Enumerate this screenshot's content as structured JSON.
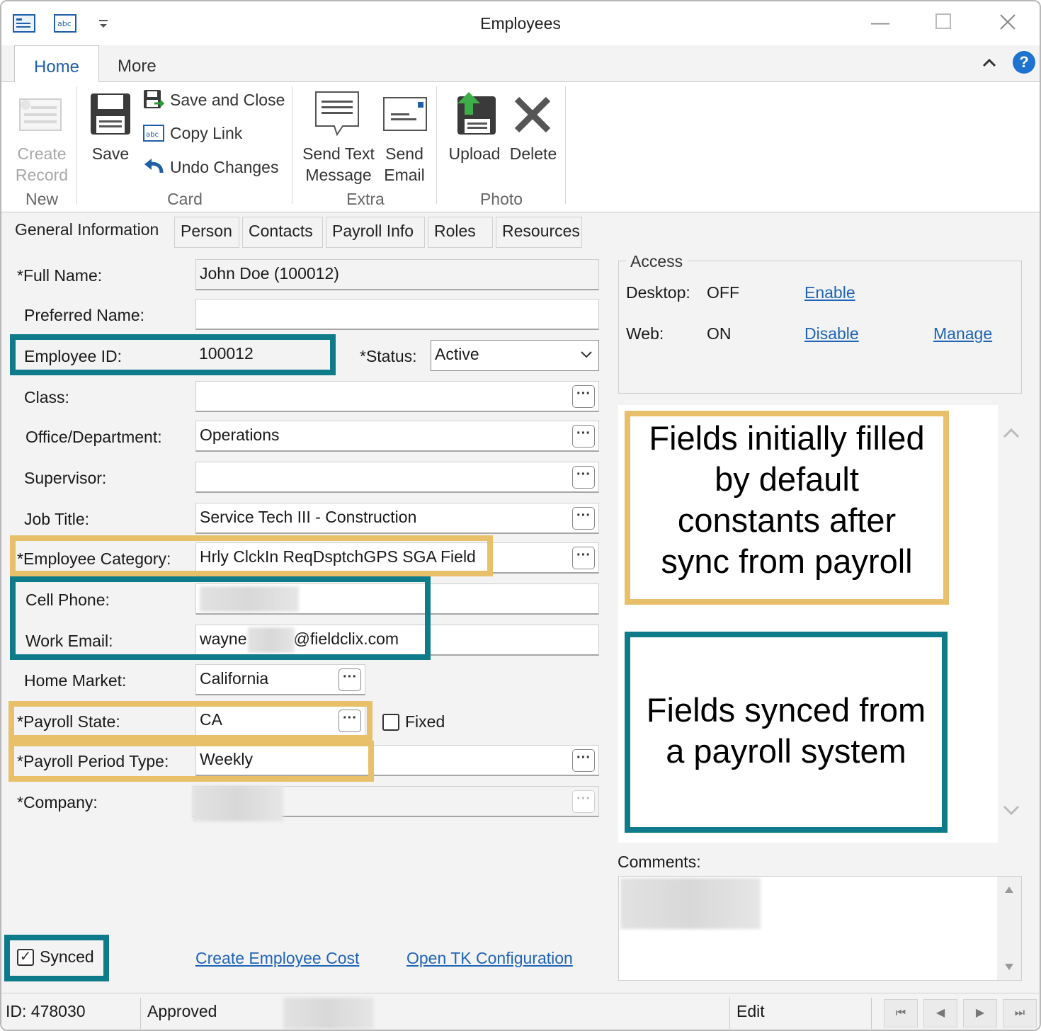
{
  "window": {
    "title": "Employees",
    "help": "?"
  },
  "ribbon_tabs": [
    "Home",
    "More"
  ],
  "ribbon": {
    "new": {
      "create_line1": "Create",
      "create_line2": "Record",
      "group": "New"
    },
    "card": {
      "save": "Save",
      "save_close": "Save and Close",
      "copy_link": "Copy Link",
      "undo": "Undo Changes",
      "group": "Card"
    },
    "extra": {
      "send_text_1": "Send Text",
      "send_text_2": "Message",
      "send_email_1": "Send",
      "send_email_2": "Email",
      "group": "Extra"
    },
    "photo": {
      "upload": "Upload",
      "delete": "Delete",
      "group": "Photo"
    }
  },
  "form_tabs": [
    "General Information",
    "Person",
    "Contacts",
    "Payroll Info",
    "Roles",
    "Resources"
  ],
  "fields": {
    "full_name": {
      "label": "*Full Name:",
      "value": "John Doe (100012)"
    },
    "preferred_name": {
      "label": "Preferred Name:",
      "value": ""
    },
    "employee_id": {
      "label": "Employee ID:",
      "value": "100012"
    },
    "status": {
      "label": "*Status:",
      "value": "Active"
    },
    "class": {
      "label": "Class:",
      "value": ""
    },
    "office": {
      "label": "Office/Department:",
      "value": "Operations"
    },
    "supervisor": {
      "label": "Supervisor:",
      "value": ""
    },
    "job_title": {
      "label": "Job Title:",
      "value": "Service Tech III - Construction"
    },
    "employee_category": {
      "label": "*Employee Category:",
      "value": "Hrly ClckIn ReqDsptchGPS SGA Field"
    },
    "cell_phone": {
      "label": "Cell Phone:",
      "value": ""
    },
    "work_email": {
      "label": "Work Email:",
      "value_prefix": "wayne",
      "value_suffix": "@fieldclix.com"
    },
    "home_market": {
      "label": "Home Market:",
      "value": "California"
    },
    "payroll_state": {
      "label": "*Payroll State:",
      "value": "CA",
      "fixed_label": "Fixed"
    },
    "payroll_period": {
      "label": "*Payroll Period Type:",
      "value": "Weekly"
    },
    "company": {
      "label": "*Company:",
      "value": ""
    }
  },
  "access": {
    "title": "Access",
    "desktop_label": "Desktop:",
    "desktop_value": "OFF",
    "desktop_link": "Enable",
    "web_label": "Web:",
    "web_value": "ON",
    "web_link": "Disable",
    "manage_link": "Manage"
  },
  "annotations": {
    "defaults_line1": "Fields initially filled",
    "defaults_line2": "by default",
    "defaults_line3": "constants after",
    "defaults_line4": "sync from payroll",
    "synced_line1": "Fields synced from",
    "synced_line2": "a payroll system"
  },
  "comments_label": "Comments:",
  "bottom": {
    "synced_label": "Synced",
    "synced_checked": true,
    "link_cost": "Create Employee Cost",
    "link_tk": "Open TK Configuration"
  },
  "status_bar": {
    "id": "ID: 478030",
    "state": "Approved",
    "mode": "Edit"
  },
  "colors": {
    "teal_highlight": "#0d7b8a",
    "gold_highlight": "#e8c06a",
    "link": "#1f64b6",
    "tab_active": "#1e5fa8"
  }
}
